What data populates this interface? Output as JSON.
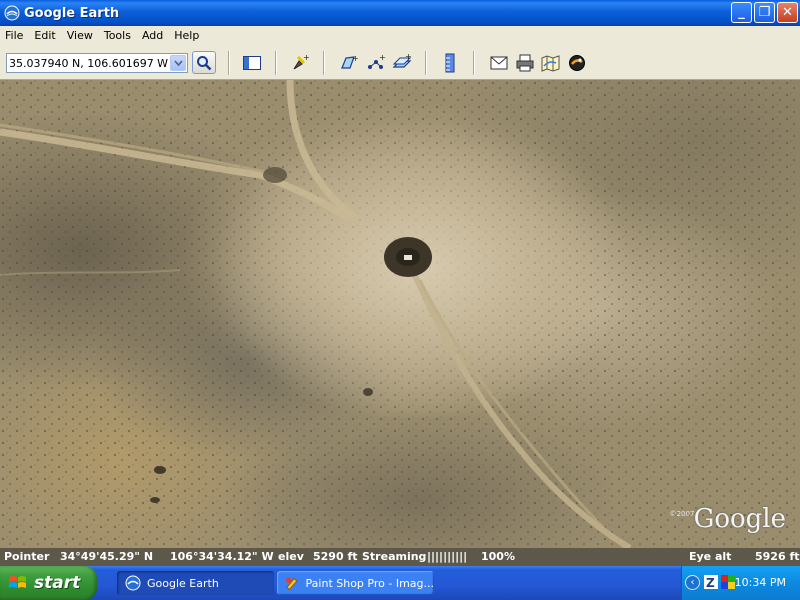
{
  "window": {
    "title": "Google Earth",
    "controls": {
      "minimize": "_",
      "maximize": "❐",
      "close": "✕"
    }
  },
  "menu": [
    "File",
    "Edit",
    "View",
    "Tools",
    "Add",
    "Help"
  ],
  "toolbar": {
    "coordinate_value": "35.037940 N, 106.601697 W",
    "icons": [
      "search-icon",
      "sidebar-toggle-icon",
      "add-placemark-icon",
      "add-polygon-icon",
      "add-path-icon",
      "add-image-overlay-icon",
      "ruler-icon",
      "email-icon",
      "print-icon",
      "google-maps-icon",
      "sky-switch-icon"
    ]
  },
  "map": {
    "copyright": "©2007",
    "logo": "Google"
  },
  "status": {
    "pointer_label": "Pointer",
    "latitude": "34°49'45.29\" N",
    "longitude": "106°34'34.12\" W",
    "elev_label": "elev",
    "elevation": "5290 ft",
    "streaming_label": "Streaming",
    "streaming_bar": "||||||||||",
    "streaming_percent": "100%",
    "eye_alt_label": "Eye alt",
    "eye_alt_value": "5926 ft"
  },
  "taskbar": {
    "start_label": "start",
    "tasks": [
      {
        "label": "Google Earth",
        "active": true
      },
      {
        "label": "Paint Shop Pro - Imag...",
        "active": false
      }
    ],
    "clock": "10:34 PM"
  },
  "colors": {
    "titlebar": "#0b5fd8",
    "taskbar": "#245edb",
    "start_button": "#3e9b3e",
    "chrome": "#ece9d8",
    "statusbar": "#5d584a"
  }
}
